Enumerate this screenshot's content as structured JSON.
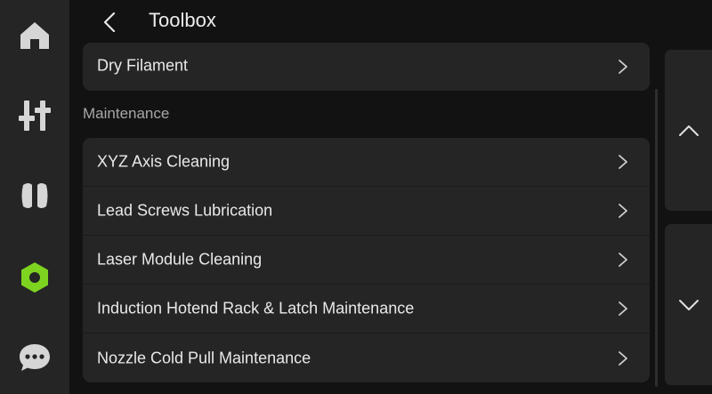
{
  "header": {
    "title": "Toolbox"
  },
  "nav": [
    {
      "icon": "home-icon"
    },
    {
      "icon": "controls-icon"
    },
    {
      "icon": "filament-icon"
    },
    {
      "icon": "toolbox-nut-icon",
      "active": true
    },
    {
      "icon": "chat-icon"
    }
  ],
  "top_item": {
    "label": "Dry Filament"
  },
  "maintenance": {
    "section_label": "Maintenance",
    "items": [
      {
        "label": "XYZ Axis Cleaning"
      },
      {
        "label": "Lead Screws Lubrication"
      },
      {
        "label": "Laser Module Cleaning"
      },
      {
        "label": "Induction Hotend Rack & Latch Maintenance"
      },
      {
        "label": "Nozzle Cold Pull Maintenance"
      }
    ]
  },
  "colors": {
    "accent": "#7ed321",
    "background": "#121212",
    "panel": "#252525"
  }
}
